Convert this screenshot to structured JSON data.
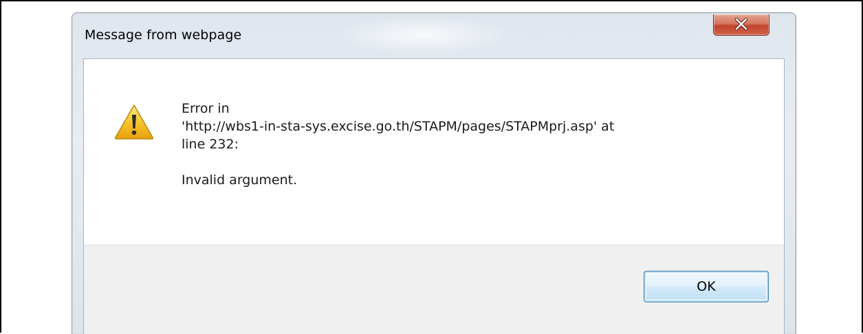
{
  "dialog": {
    "title": "Message from webpage",
    "close_icon": "close-x-icon",
    "message_icon": "warning-triangle-icon",
    "message_lines": [
      "Error in",
      "'http://wbs1-in-sta-sys.excise.go.th/STAPM/pages/STAPMprj.asp' at",
      "line 232:"
    ],
    "detail": "Invalid argument.",
    "ok_label": "OK",
    "colors": {
      "close_button": "#c0432b",
      "ok_button_border": "#3c7fb1",
      "button_bar": "#f0f0f0",
      "warning_fill": "#f7c52b"
    }
  }
}
